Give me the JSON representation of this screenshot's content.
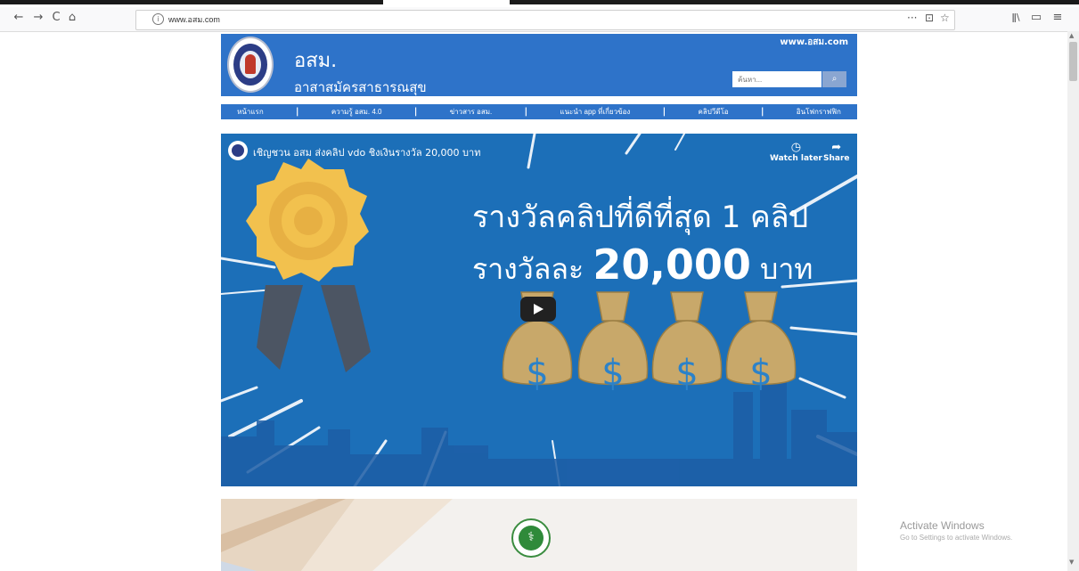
{
  "browser": {
    "nav": {
      "back": "←",
      "forward": "→",
      "reload": "C",
      "home": "⌂"
    },
    "url": "www.อสม.com",
    "url_actions": {
      "more": "···",
      "pocket": "⊡",
      "bookmark": "☆"
    },
    "toolbar_right": {
      "library": "ǁ\\",
      "sidebar": "▭",
      "menu": "≡"
    }
  },
  "site": {
    "title": "อสม.",
    "subtitle": "อาสาสมัครสาธารณสุข",
    "domain": "www.อสม.com",
    "search_placeholder": "ค้นหา...",
    "search_button": "🔍",
    "brand_color": "#2e73c9"
  },
  "nav": {
    "items": [
      "หน้าแรก",
      "ความรู้ อสม. 4.0",
      "ข่าวสาร อสม.",
      "แนะนำ app ที่เกี่ยวข้อง",
      "คลิปวีดีโอ",
      "อินโฟกราฟฟิก"
    ],
    "separator": "|"
  },
  "video": {
    "title": "เชิญชวน อสม ส่งคลิป vdo ชิงเงินรางวัล 20,000 บาท",
    "watch_later": "Watch later",
    "share": "Share",
    "headline1": "รางวัลคลิปที่ดีที่สุด 1 คลิป",
    "headline2_prefix": "รางวัลละ",
    "headline2_amount": "20,000",
    "headline2_suffix": "บาท",
    "bag_symbol": "$"
  },
  "watermark": {
    "line1": "Activate Windows",
    "line2": "Go to Settings to activate Windows."
  },
  "scroll": {
    "up": "▲",
    "down": "▼"
  }
}
